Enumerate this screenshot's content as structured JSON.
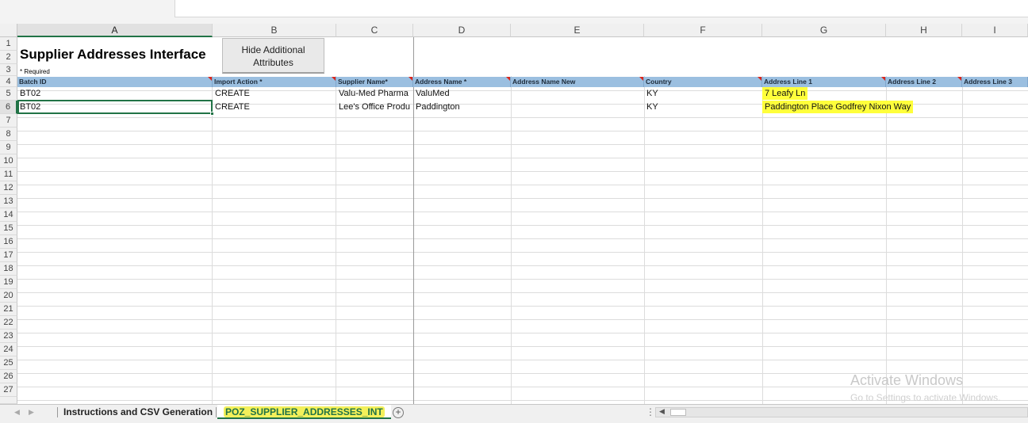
{
  "columns": [
    "A",
    "B",
    "C",
    "D",
    "E",
    "F",
    "G",
    "H",
    "I"
  ],
  "rows": [
    "1",
    "2",
    "3",
    "4",
    "5",
    "6",
    "7",
    "8",
    "9",
    "10",
    "11",
    "12",
    "13",
    "14",
    "15",
    "16",
    "17",
    "18",
    "19",
    "20",
    "21",
    "22",
    "23",
    "24",
    "25",
    "26",
    "27"
  ],
  "sheet": {
    "title": "Supplier Addresses Interface",
    "required_note": "* Required",
    "hide_button": "Hide Additional Attributes",
    "headers": {
      "batch_id": "Batch ID",
      "import_action": "Import Action *",
      "supplier_name": "Supplier Name*",
      "address_name": "Address Name *",
      "address_name_new": "Address Name New",
      "country": "Country",
      "address_line_1": "Address Line 1",
      "address_line_2": "Address Line 2",
      "address_line_3": "Address Line 3"
    },
    "data_rows": [
      {
        "batch_id": "BT02",
        "import_action": "CREATE",
        "supplier_name": "Valu-Med Pharma",
        "address_name": "ValuMed",
        "country": "KY",
        "address_line_1": "7 Leafy Ln"
      },
      {
        "batch_id": "BT02",
        "import_action": "CREATE",
        "supplier_name": "Lee's Office Produ",
        "address_name": "Paddington",
        "country": "KY",
        "address_line_1": "Paddington Place Godfrey Nixon Way"
      }
    ]
  },
  "tabs": {
    "instructions": "Instructions and CSV Generation",
    "poz": "POZ_SUPPLIER_ADDRESSES_INT",
    "add_icon": "plus-circle-icon"
  },
  "watermark": {
    "title": "Activate Windows",
    "subtitle": "Go to Settings to activate Windows."
  },
  "colors": {
    "header_blue": "#9bbfe0",
    "highlight_yellow": "#ffff3b",
    "excel_green": "#217346"
  }
}
